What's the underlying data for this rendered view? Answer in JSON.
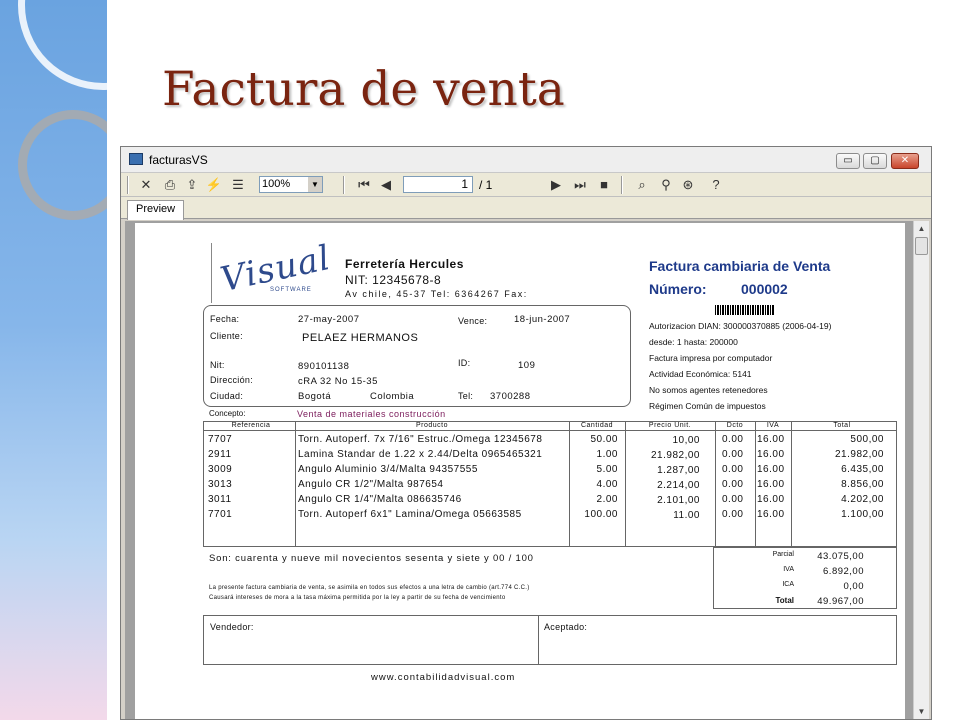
{
  "slide": {
    "title": "Factura de venta"
  },
  "window": {
    "title": "facturasVS",
    "controls": {
      "minimize": "▭",
      "maximize": "▢",
      "close": "✕"
    },
    "toolbar": {
      "zoom": "100%",
      "page": "1",
      "page_count": "/ 1"
    },
    "tab": "Preview"
  },
  "company": {
    "logo_word": "Visual",
    "logo_sub": "SOFTWARE",
    "name": "Ferretería Hercules",
    "nit": "NIT: 12345678-8",
    "address": "Av chile, 45-37 Tel: 6364267 Fax:"
  },
  "invoice": {
    "title": "Factura cambiaria de Venta",
    "number_label": "Número:",
    "number": "000002",
    "legal": [
      "Autorizacion DIAN: 300000370885 (2006-04-19)",
      "desde: 1     hasta: 200000",
      "Factura impresa por computador",
      "Actividad Económica: 5141",
      "No somos agentes retenedores",
      "Régimen Común de impuestos"
    ]
  },
  "customer": {
    "fecha_label": "Fecha:",
    "fecha": "27-may-2007",
    "vence_label": "Vence:",
    "vence": "18-jun-2007",
    "cliente_label": "Cliente:",
    "cliente": "PELAEZ HERMANOS",
    "nit_label": "Nit:",
    "nit": "890101138",
    "id_label": "ID:",
    "id": "109",
    "direccion_label": "Dirección:",
    "direccion": "cRA 32 No 15-35",
    "ciudad_label": "Ciudad:",
    "ciudad": "Bogotá",
    "pais": "Colombia",
    "tel_label": "Tel:",
    "tel": "3700288",
    "concepto_label": "Concepto:",
    "concepto": "Venta de materiales construcción"
  },
  "items": {
    "headers": [
      "Referencia",
      "Producto",
      "Cantidad",
      "Precio Unit.",
      "Dcto",
      "IVA",
      "Total"
    ],
    "rows": [
      {
        "ref": "7707",
        "product": "Torn. Autoperf. 7x 7/16\" Estruc./Omega 12345678",
        "qty": "50.00",
        "price": "10,00",
        "dcto": "0.00",
        "iva": "16.00",
        "total": "500,00"
      },
      {
        "ref": "2911",
        "product": "Lamina Standar de 1.22 x 2.44/Delta 0965465321",
        "qty": "1.00",
        "price": "21.982,00",
        "dcto": "0.00",
        "iva": "16.00",
        "total": "21.982,00"
      },
      {
        "ref": "3009",
        "product": "Angulo Aluminio 3/4/Malta 94357555",
        "qty": "5.00",
        "price": "1.287,00",
        "dcto": "0.00",
        "iva": "16.00",
        "total": "6.435,00"
      },
      {
        "ref": "3013",
        "product": "Angulo CR 1/2\"/Malta 987654",
        "qty": "4.00",
        "price": "2.214,00",
        "dcto": "0.00",
        "iva": "16.00",
        "total": "8.856,00"
      },
      {
        "ref": "3011",
        "product": "Angulo CR 1/4\"/Malta 086635746",
        "qty": "2.00",
        "price": "2.101,00",
        "dcto": "0.00",
        "iva": "16.00",
        "total": "4.202,00"
      },
      {
        "ref": "7701",
        "product": "Torn. Autoperf 6x1\" Lamina/Omega 05663585",
        "qty": "100.00",
        "price": "11.00",
        "dcto": "0.00",
        "iva": "16.00",
        "total": "1.100,00"
      }
    ]
  },
  "footer": {
    "son": "Son: cuarenta y nueve mil novecientos sesenta y siete y 00 / 100",
    "fine1": "La presente factura cambiaria de venta, se asimila en todos sus efectos a una letra de cambio (art.774 C.C.)",
    "fine2": "Causará intereses de mora a la tasa máxima permitida por la ley a partir de su fecha de vencimiento",
    "totals": [
      {
        "label": "Parcial",
        "value": "43.075,00"
      },
      {
        "label": "IVA",
        "value": "6.892,00"
      },
      {
        "label": "ICA",
        "value": "0,00"
      },
      {
        "label": "Total",
        "value": "49.967,00"
      }
    ],
    "vendedor": "Vendedor:",
    "aceptado": "Aceptado:",
    "web": "www.contabilidadvisual.com"
  }
}
